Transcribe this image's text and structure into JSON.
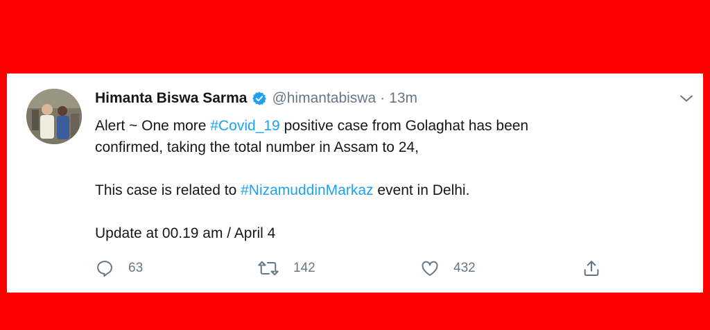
{
  "tweet": {
    "author_name": "Himanta Biswa Sarma",
    "handle": "@himantabiswa",
    "separator": "·",
    "time": "13m",
    "body": {
      "line1_prefix": "Alert ~ One more ",
      "hashtag1": "#Covid_19",
      "line1_suffix": " positive case from Golaghat  has been",
      "line2": "confirmed, taking the total number in Assam to 24,",
      "line3_prefix": "This case is related to ",
      "hashtag2": "#NizamuddinMarkaz",
      "line3_suffix": " event in Delhi.",
      "line4": "Update at 00.19 am / April 4"
    },
    "actions": {
      "replies": "63",
      "retweets": "142",
      "likes": "432"
    }
  },
  "colors": {
    "background": "#ff0000",
    "card": "#ffffff",
    "text": "#14171a",
    "muted": "#657786",
    "accent": "#1da1f2"
  },
  "icons": [
    "verified-badge-icon",
    "chevron-down-icon",
    "reply-icon",
    "retweet-icon",
    "like-icon",
    "share-icon"
  ]
}
